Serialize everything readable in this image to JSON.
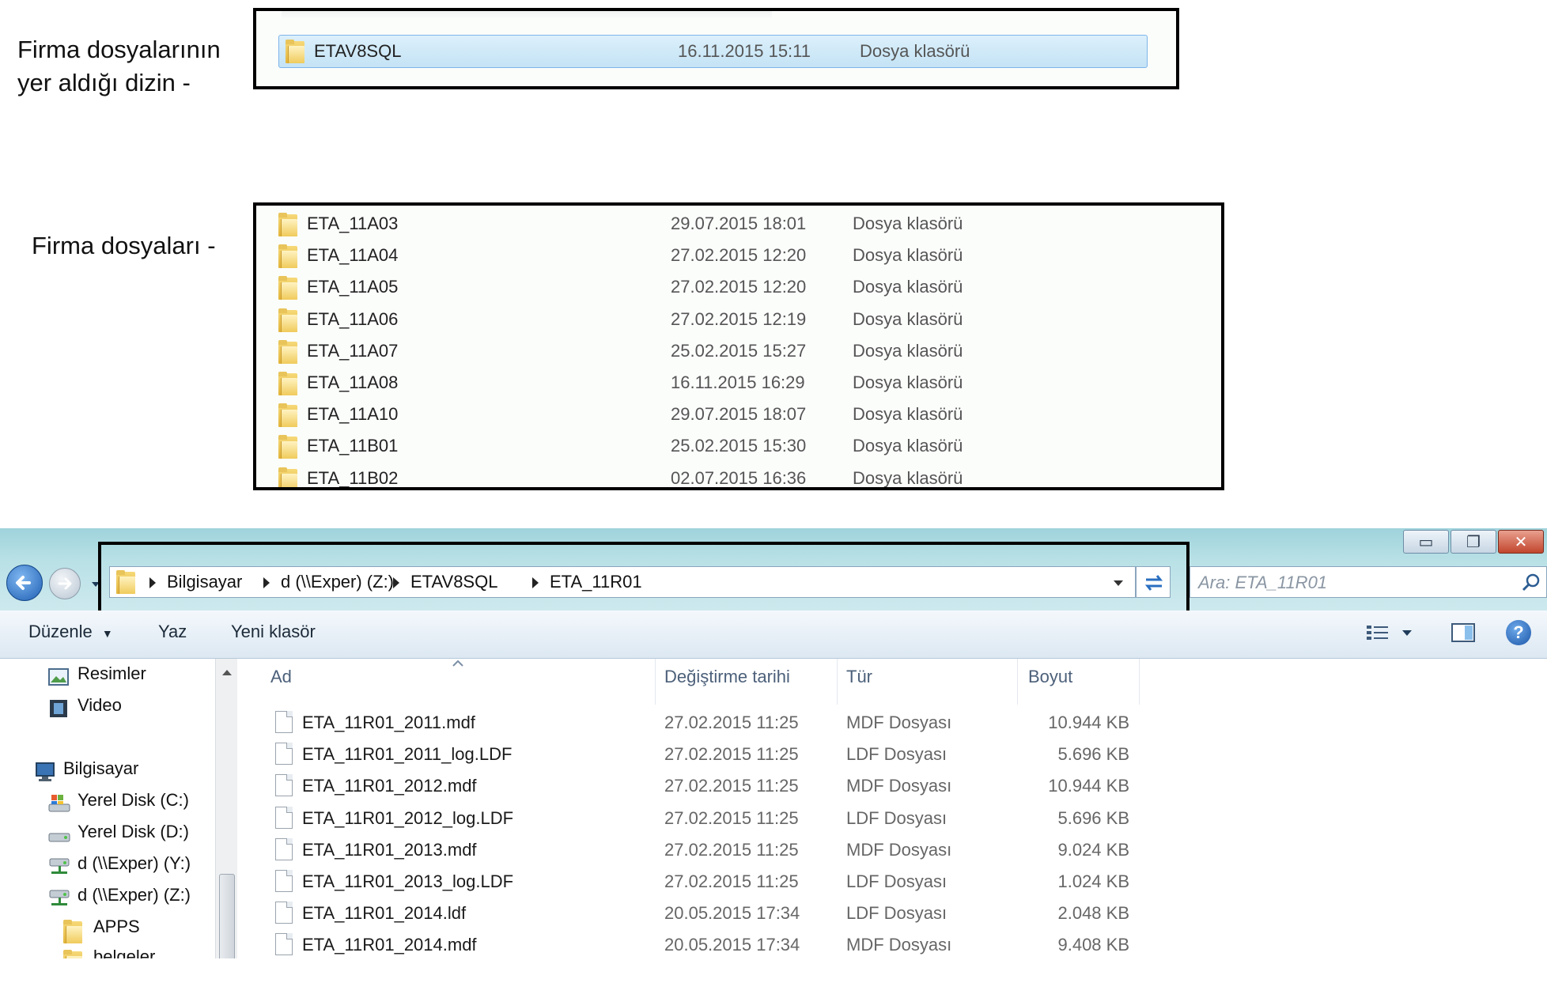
{
  "annotations": {
    "directory_label": "Firma dosyalarının yer aldığı dizin -",
    "company_files_label": "Firma dosyaları -"
  },
  "top_excerpt": {
    "selected_row": {
      "name": "ETAV8SQL",
      "date": "16.11.2015 15:11",
      "type": "Dosya klasörü"
    }
  },
  "middle_excerpt": {
    "rows": [
      {
        "name": "ETA_11A03",
        "date": "29.07.2015 18:01",
        "type": "Dosya klasörü"
      },
      {
        "name": "ETA_11A04",
        "date": "27.02.2015 12:20",
        "type": "Dosya klasörü"
      },
      {
        "name": "ETA_11A05",
        "date": "27.02.2015 12:20",
        "type": "Dosya klasörü"
      },
      {
        "name": "ETA_11A06",
        "date": "27.02.2015 12:19",
        "type": "Dosya klasörü"
      },
      {
        "name": "ETA_11A07",
        "date": "25.02.2015 15:27",
        "type": "Dosya klasörü"
      },
      {
        "name": "ETA_11A08",
        "date": "16.11.2015 16:29",
        "type": "Dosya klasörü"
      },
      {
        "name": "ETA_11A10",
        "date": "29.07.2015 18:07",
        "type": "Dosya klasörü"
      },
      {
        "name": "ETA_11B01",
        "date": "25.02.2015 15:30",
        "type": "Dosya klasörü"
      },
      {
        "name": "ETA_11B02",
        "date": "02.07.2015 16:36",
        "type": "Dosya klasörü"
      }
    ]
  },
  "window": {
    "breadcrumb": [
      "Bilgisayar",
      "d (\\\\Exper) (Z:)",
      "ETAV8SQL",
      "ETA_11R01"
    ],
    "search_placeholder": "Ara: ETA_11R01",
    "toolbar": {
      "organize": "Düzenle",
      "burn": "Yaz",
      "new_folder": "Yeni klasör"
    },
    "nav_items": [
      {
        "label": "Resimler",
        "icon": "pictures-icon"
      },
      {
        "label": "Video",
        "icon": "video-icon"
      },
      {
        "label": "Bilgisayar",
        "icon": "computer-icon"
      },
      {
        "label": "Yerel Disk (C:)",
        "icon": "system-drive-icon"
      },
      {
        "label": "Yerel Disk (D:)",
        "icon": "drive-icon"
      },
      {
        "label": "d (\\\\Exper) (Y:)",
        "icon": "network-drive-icon"
      },
      {
        "label": "d (\\\\Exper) (Z:)",
        "icon": "network-drive-icon"
      },
      {
        "label": "APPS",
        "icon": "folder-icon"
      },
      {
        "label": "belgeler",
        "icon": "folder-icon"
      }
    ],
    "columns": {
      "name": "Ad",
      "date": "Değiştirme tarihi",
      "type": "Tür",
      "size": "Boyut"
    },
    "files": [
      {
        "name": "ETA_11R01_2011.mdf",
        "date": "27.02.2015 11:25",
        "type": "MDF Dosyası",
        "size": "10.944 KB"
      },
      {
        "name": "ETA_11R01_2011_log.LDF",
        "date": "27.02.2015 11:25",
        "type": "LDF Dosyası",
        "size": "5.696 KB"
      },
      {
        "name": "ETA_11R01_2012.mdf",
        "date": "27.02.2015 11:25",
        "type": "MDF Dosyası",
        "size": "10.944 KB"
      },
      {
        "name": "ETA_11R01_2012_log.LDF",
        "date": "27.02.2015 11:25",
        "type": "LDF Dosyası",
        "size": "5.696 KB"
      },
      {
        "name": "ETA_11R01_2013.mdf",
        "date": "27.02.2015 11:25",
        "type": "MDF Dosyası",
        "size": "9.024 KB"
      },
      {
        "name": "ETA_11R01_2013_log.LDF",
        "date": "27.02.2015 11:25",
        "type": "LDF Dosyası",
        "size": "1.024 KB"
      },
      {
        "name": "ETA_11R01_2014.ldf",
        "date": "20.05.2015 17:34",
        "type": "LDF Dosyası",
        "size": "2.048 KB"
      },
      {
        "name": "ETA_11R01_2014.mdf",
        "date": "20.05.2015 17:34",
        "type": "MDF Dosyası",
        "size": "9.408 KB"
      }
    ]
  },
  "colors": {
    "selection": "#cde8f7",
    "selection_border": "#7eb4ea",
    "title_bar": "#b9e1e6",
    "close_button": "#c2452d"
  }
}
